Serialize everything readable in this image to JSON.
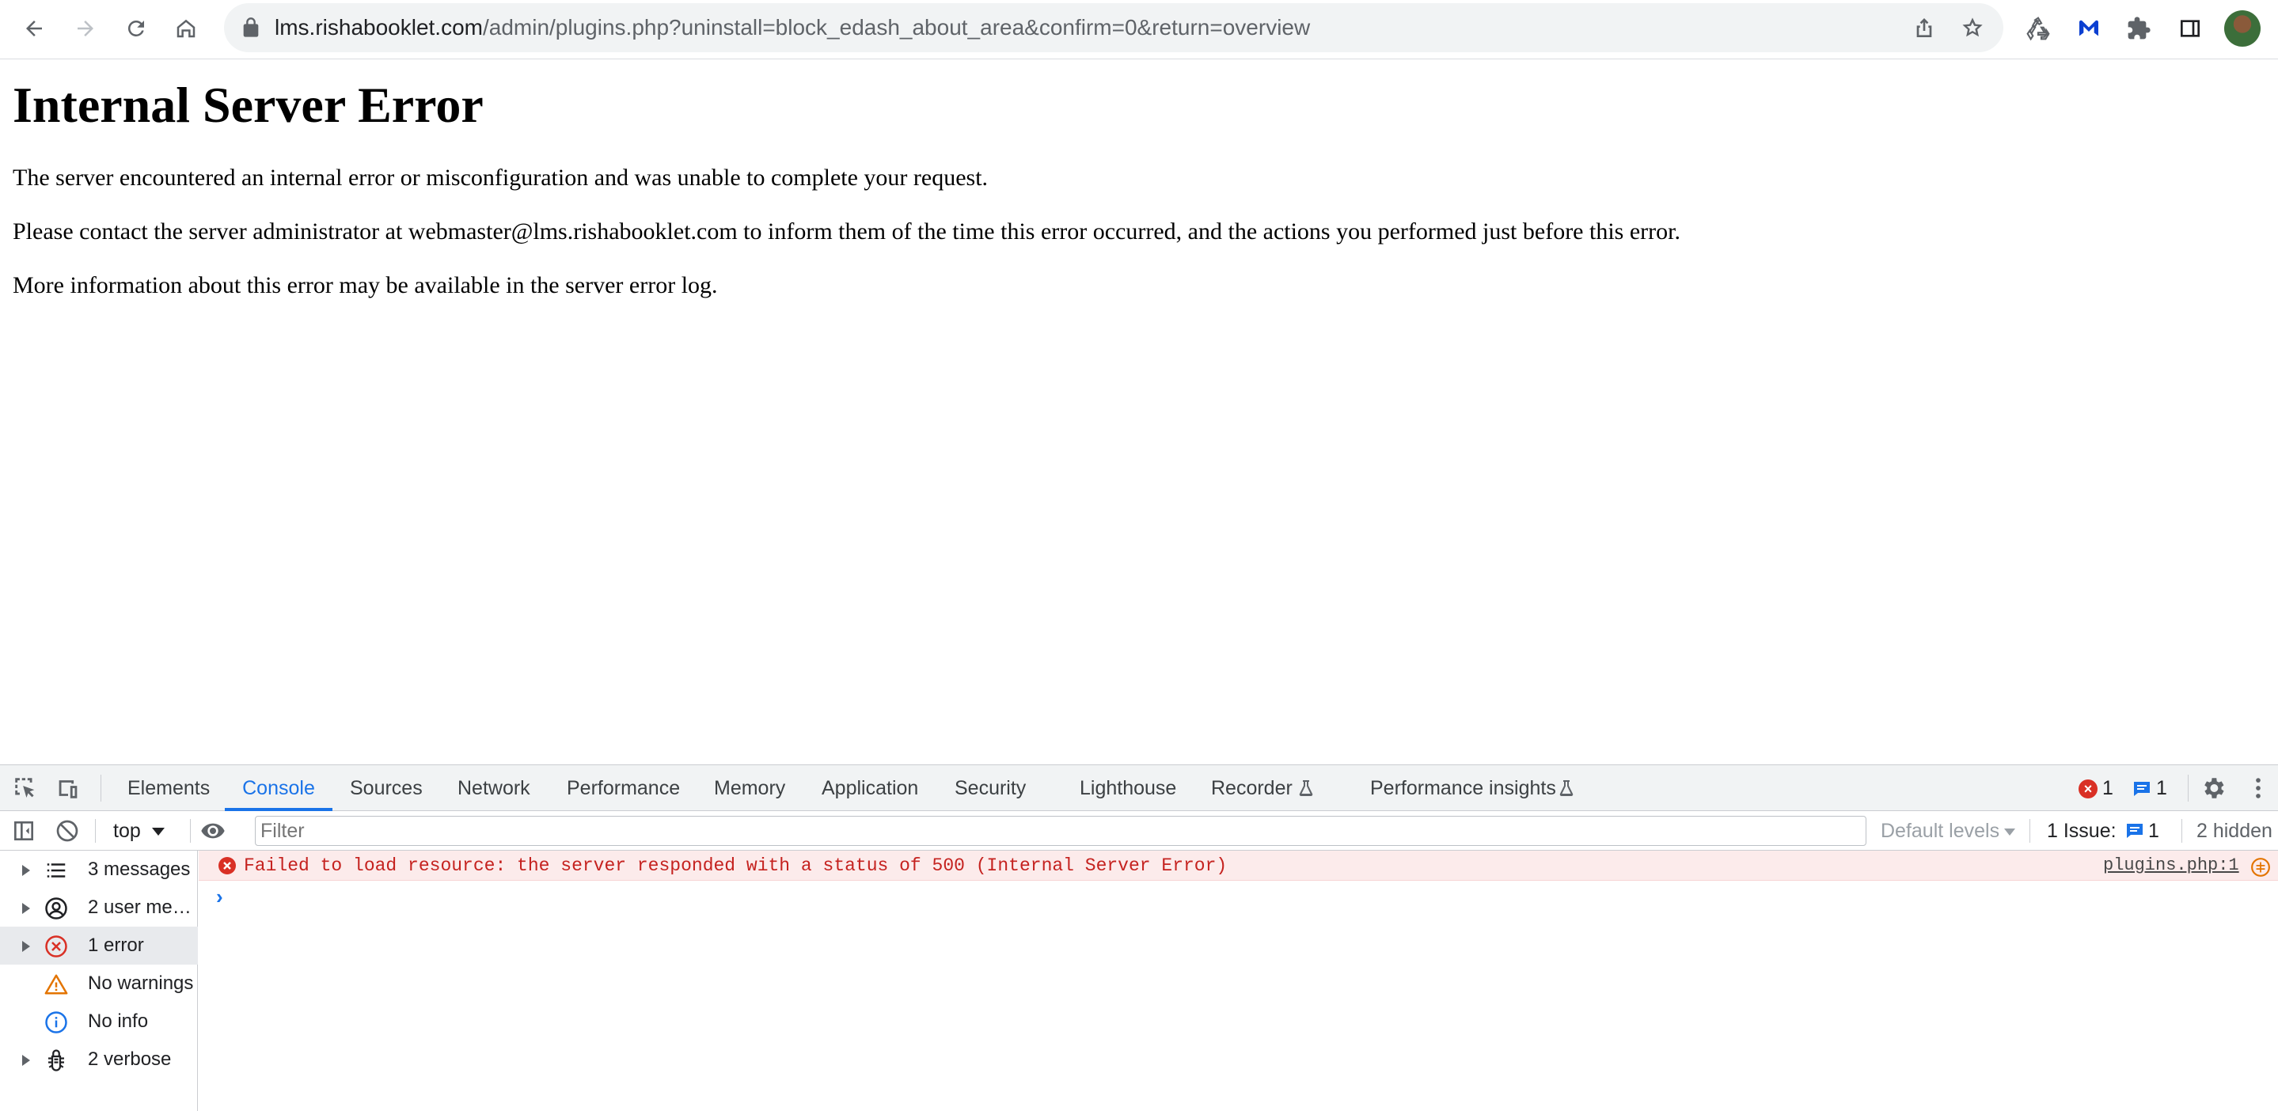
{
  "browser": {
    "url_host": "lms.rishabooklet.com",
    "url_path": "/admin/plugins.php?uninstall=block_edash_about_area&confirm=0&return=overview",
    "icons": [
      "back-icon",
      "forward-icon",
      "reload-icon",
      "home-icon",
      "lock-icon",
      "share-icon",
      "bookmark-star-icon",
      "recycle-extension-icon",
      "malwarebytes-extension-icon",
      "extensions-puzzle-icon",
      "side-panel-icon",
      "profile-avatar"
    ]
  },
  "page": {
    "title": "Internal Server Error",
    "paragraphs": [
      "The server encountered an internal error or misconfiguration and was unable to complete your request.",
      "Please contact the server administrator at webmaster@lms.rishabooklet.com to inform them of the time this error occurred, and the actions you performed just before this error.",
      "More information about this error may be available in the server error log."
    ]
  },
  "devtools": {
    "tabs": [
      "Elements",
      "Console",
      "Sources",
      "Network",
      "Performance",
      "Memory",
      "Application",
      "Security",
      "Lighthouse",
      "Recorder",
      "Performance insights"
    ],
    "active_tab": "Console",
    "error_count": "1",
    "message_count": "1",
    "filterbar": {
      "context": "top",
      "filter_placeholder": "Filter",
      "levels": "Default levels",
      "issues_label": "1 Issue:",
      "issues_count": "1",
      "hidden": "2 hidden"
    },
    "sidebar": [
      {
        "label": "3 messages",
        "icon": "list-icon",
        "expandable": true
      },
      {
        "label": "2 user me…",
        "icon": "user-icon",
        "expandable": true
      },
      {
        "label": "1 error",
        "icon": "error-icon",
        "expandable": true
      },
      {
        "label": "No warnings",
        "icon": "warning-icon",
        "expandable": false
      },
      {
        "label": "No info",
        "icon": "info-icon",
        "expandable": false
      },
      {
        "label": "2 verbose",
        "icon": "bug-icon",
        "expandable": true
      }
    ],
    "console": {
      "error_message": "Failed to load resource: the server responded with a status of 500 (Internal Server Error)",
      "error_source": "plugins.php:1",
      "prompt": "›"
    },
    "colors": {
      "accent": "#1a73e8",
      "error": "#d93025",
      "error_bg": "#fcebeb",
      "warning": "#e37400"
    }
  }
}
